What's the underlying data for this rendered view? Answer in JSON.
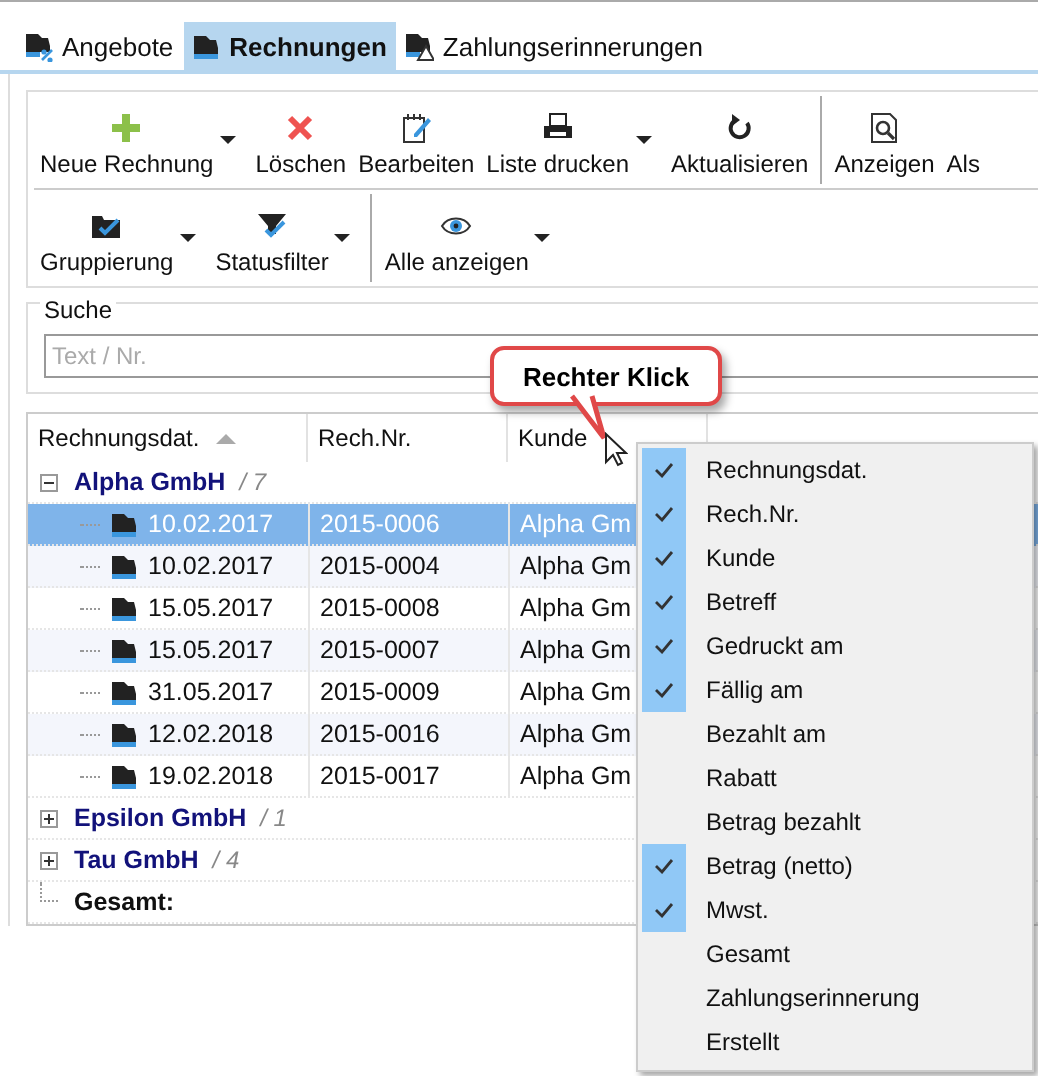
{
  "tabs": [
    {
      "label": "Angebote",
      "selected": false
    },
    {
      "label": "Rechnungen",
      "selected": true
    },
    {
      "label": "Zahlungserinnerungen",
      "selected": false
    }
  ],
  "toolbar": {
    "rows": [
      [
        {
          "kind": "button",
          "label": "Neue Rechnung",
          "dropdown": true
        },
        {
          "kind": "button",
          "label": "Löschen",
          "dropdown": false
        },
        {
          "kind": "button",
          "label": "Bearbeiten",
          "dropdown": false
        },
        {
          "kind": "button",
          "label": "Liste drucken",
          "dropdown": true
        },
        {
          "kind": "button",
          "label": "Aktualisieren",
          "dropdown": false
        },
        {
          "kind": "separator"
        },
        {
          "kind": "button",
          "label": "Anzeigen",
          "dropdown": false
        },
        {
          "kind": "button",
          "label": "Als",
          "dropdown": false
        }
      ],
      [
        {
          "kind": "button",
          "label": "Gruppierung",
          "dropdown": true
        },
        {
          "kind": "button",
          "label": "Statusfilter",
          "dropdown": true
        },
        {
          "kind": "separator"
        },
        {
          "kind": "button",
          "label": "Alle anzeigen",
          "dropdown": true
        }
      ]
    ]
  },
  "search": {
    "label": "Suche",
    "placeholder": "Text / Nr."
  },
  "table": {
    "columns": [
      {
        "label": "Rechnungsdat.",
        "sorted": true
      },
      {
        "label": "Rech.Nr.",
        "sorted": false
      },
      {
        "label": "Kunde",
        "sorted": false
      }
    ],
    "groups": [
      {
        "name": "Alpha GmbH",
        "count": "/ 7",
        "expanded": true,
        "rows": [
          {
            "date": "10.02.2017",
            "number": "2015-0006",
            "customer": "Alpha Gm",
            "selected": true
          },
          {
            "date": "10.02.2017",
            "number": "2015-0004",
            "customer": "Alpha Gm",
            "selected": false
          },
          {
            "date": "15.05.2017",
            "number": "2015-0008",
            "customer": "Alpha Gm",
            "selected": false
          },
          {
            "date": "15.05.2017",
            "number": "2015-0007",
            "customer": "Alpha Gm",
            "selected": false
          },
          {
            "date": "31.05.2017",
            "number": "2015-0009",
            "customer": "Alpha Gm",
            "selected": false
          },
          {
            "date": "12.02.2018",
            "number": "2015-0016",
            "customer": "Alpha Gm",
            "selected": false
          },
          {
            "date": "19.02.2018",
            "number": "2015-0017",
            "customer": "Alpha Gm",
            "selected": false
          }
        ]
      },
      {
        "name": "Epsilon GmbH",
        "count": "/ 1",
        "expanded": false
      },
      {
        "name": "Tau GmbH",
        "count": "/ 4",
        "expanded": false
      }
    ],
    "total_label": "Gesamt:"
  },
  "callout": {
    "text": "Rechter Klick"
  },
  "context_menu": {
    "items": [
      {
        "label": "Rechnungsdat.",
        "checked": true
      },
      {
        "label": "Rech.Nr.",
        "checked": true
      },
      {
        "label": "Kunde",
        "checked": true
      },
      {
        "label": "Betreff",
        "checked": true
      },
      {
        "label": "Gedruckt am",
        "checked": true
      },
      {
        "label": "Fällig am",
        "checked": true
      },
      {
        "label": "Bezahlt am",
        "checked": false
      },
      {
        "label": "Rabatt",
        "checked": false
      },
      {
        "label": "Betrag bezahlt",
        "checked": false
      },
      {
        "label": "Betrag (netto)",
        "checked": true
      },
      {
        "label": "Mwst.",
        "checked": true
      },
      {
        "label": "Gesamt",
        "checked": false
      },
      {
        "label": "Zahlungserinnerung",
        "checked": false
      },
      {
        "label": "Erstellt",
        "checked": false
      }
    ]
  }
}
